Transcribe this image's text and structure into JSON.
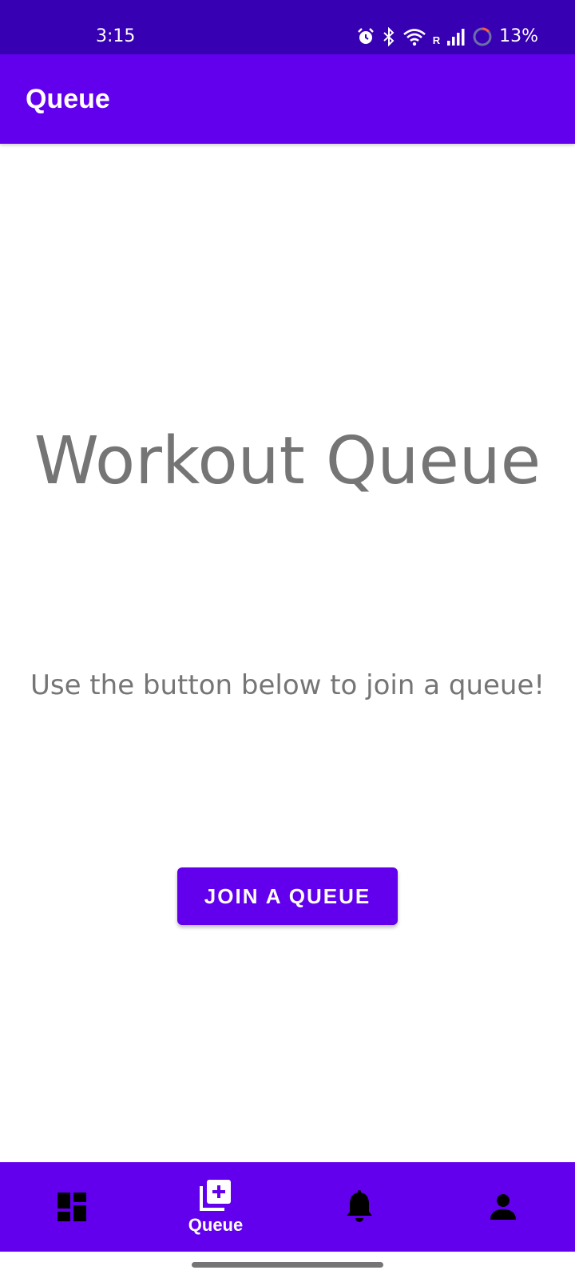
{
  "status_bar": {
    "time": "3:15",
    "battery": "13%",
    "icons": [
      "alarm-icon",
      "bluetooth-icon",
      "wifi-icon",
      "signal-icon",
      "battery-ring-icon"
    ],
    "roaming_indicator": "R"
  },
  "app_bar": {
    "title": "Queue"
  },
  "main": {
    "title": "Workout Queue",
    "subtitle": "Use the button below to join a queue!",
    "join_button_label": "JOIN A QUEUE"
  },
  "bottom_nav": {
    "items": [
      {
        "icon": "dashboard-icon",
        "label": "",
        "selected": false
      },
      {
        "icon": "add-to-queue-icon",
        "label": "Queue",
        "selected": true
      },
      {
        "icon": "bell-icon",
        "label": "",
        "selected": false
      },
      {
        "icon": "person-icon",
        "label": "",
        "selected": false
      }
    ]
  },
  "colors": {
    "status_bar": "#3700b3",
    "primary": "#6200ee",
    "text_secondary": "#757575",
    "on_primary": "#ffffff"
  }
}
